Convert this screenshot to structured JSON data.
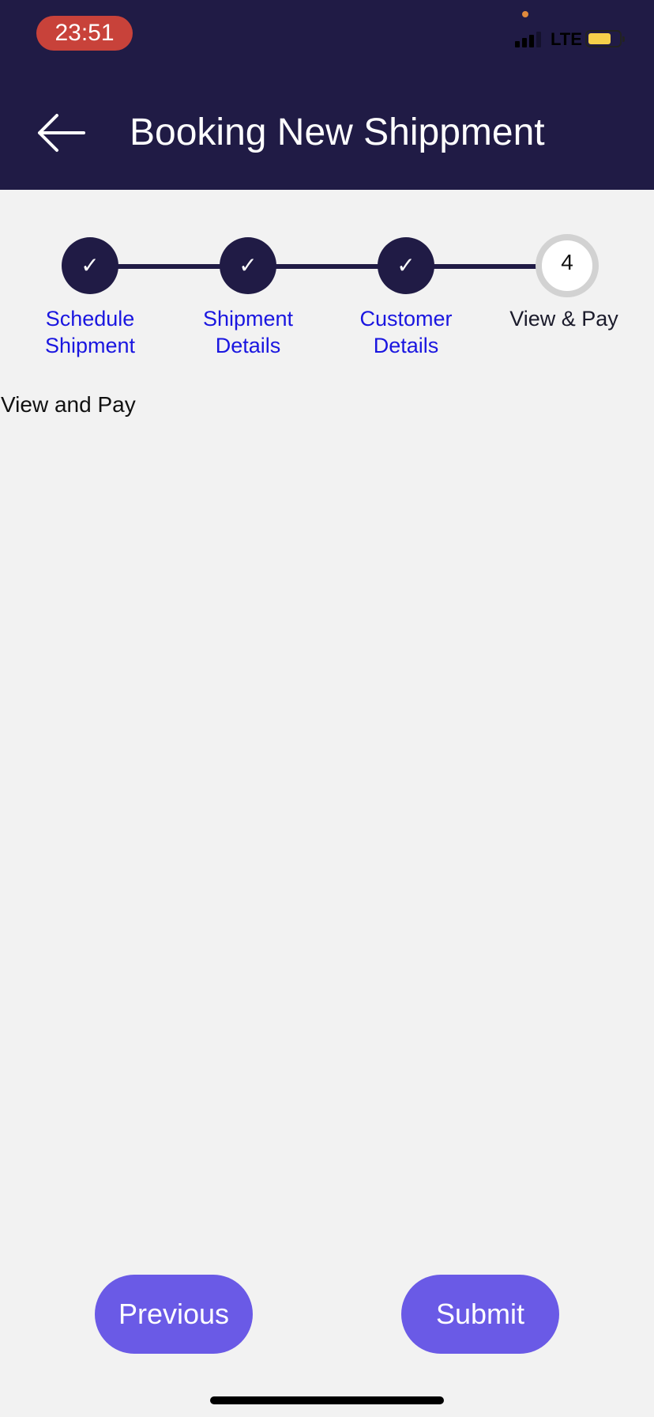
{
  "status_bar": {
    "time": "23:51",
    "network": "LTE",
    "colors": {
      "time_pill": "#c8423a",
      "battery": "#f5d04a"
    }
  },
  "header": {
    "title": "Booking New Shippment",
    "back_icon": "arrow-left-icon",
    "background": "#201b45"
  },
  "stepper": {
    "steps": [
      {
        "label_line1": "Schedule",
        "label_line2": "Shipment",
        "state": "completed",
        "icon": "checkmark-icon"
      },
      {
        "label_line1": "Shipment",
        "label_line2": "Details",
        "state": "completed",
        "icon": "checkmark-icon"
      },
      {
        "label_line1": "Customer",
        "label_line2": "Details",
        "state": "completed",
        "icon": "checkmark-icon"
      },
      {
        "label_line1": "View & Pay",
        "label_line2": "",
        "number": "4",
        "state": "current"
      }
    ],
    "completed_label_color": "#1a16e0"
  },
  "main": {
    "section_title": "View and Pay"
  },
  "footer": {
    "previous_label": "Previous",
    "submit_label": "Submit",
    "button_color": "#6a5ae6"
  }
}
